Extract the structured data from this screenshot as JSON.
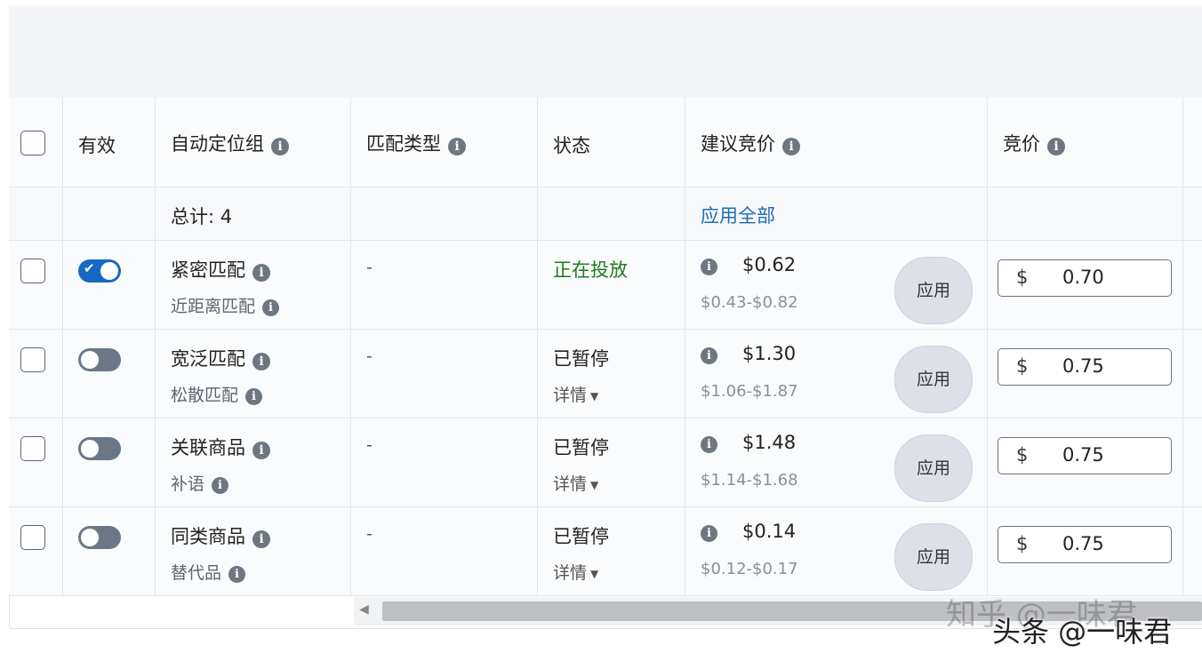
{
  "headers": {
    "valid": "有效",
    "group": "自动定位组",
    "match": "匹配类型",
    "status": "状态",
    "suggested": "建议竞价",
    "bid": "竞价"
  },
  "totals": {
    "label": "总计: 4",
    "apply_all": "应用全部"
  },
  "rows": [
    {
      "enabled": true,
      "name": "紧密匹配",
      "sub": "近距离匹配",
      "match": "-",
      "status": "正在投放",
      "details": "",
      "price": "$0.62",
      "range": "$0.43-$0.82",
      "apply": "应用",
      "currency": "$",
      "bid": "0.70"
    },
    {
      "enabled": false,
      "name": "宽泛匹配",
      "sub": "松散匹配",
      "match": "-",
      "status": "已暂停",
      "details": "详情",
      "price": "$1.30",
      "range": "$1.06-$1.87",
      "apply": "应用",
      "currency": "$",
      "bid": "0.75"
    },
    {
      "enabled": false,
      "name": "关联商品",
      "sub": "补语",
      "match": "-",
      "status": "已暂停",
      "details": "详情",
      "price": "$1.48",
      "range": "$1.14-$1.68",
      "apply": "应用",
      "currency": "$",
      "bid": "0.75"
    },
    {
      "enabled": false,
      "name": "同类商品",
      "sub": "替代品",
      "match": "-",
      "status": "已暂停",
      "details": "详情",
      "price": "$0.14",
      "range": "$0.12-$0.17",
      "apply": "应用",
      "currency": "$",
      "bid": "0.75"
    }
  ],
  "watermarks": {
    "zhihu": "知乎 @一味君",
    "toutiao": "头条 @一味君"
  },
  "colors": {
    "active_status": "#1f7a1f",
    "toggle_on": "#1768c4",
    "toggle_off": "#6b7787",
    "link": "#1b6bb8"
  }
}
